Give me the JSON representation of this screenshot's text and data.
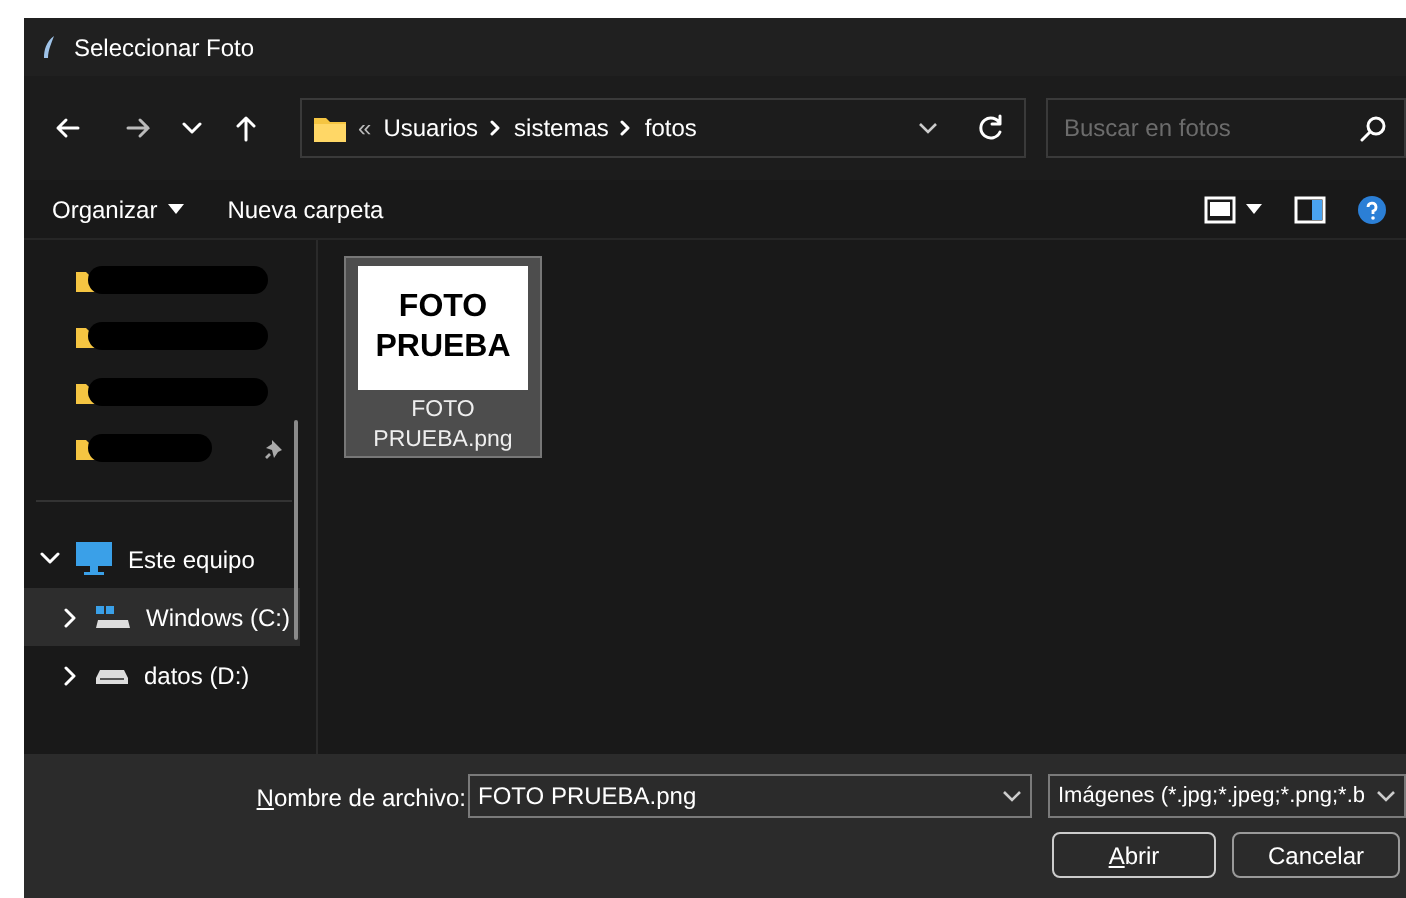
{
  "window": {
    "title": "Seleccionar Foto"
  },
  "address": {
    "overflow": "«",
    "segments": [
      "Usuarios",
      "sistemas",
      "fotos"
    ]
  },
  "search": {
    "placeholder": "Buscar en fotos"
  },
  "toolbar": {
    "organize": "Organizar",
    "new_folder": "Nueva carpeta"
  },
  "quick_access": [
    {
      "redacted": true,
      "pinned": false
    },
    {
      "redacted": true,
      "pinned": false
    },
    {
      "redacted": true,
      "pinned": false
    },
    {
      "redacted": true,
      "pinned": true
    }
  ],
  "tree": [
    {
      "label": "Este equipo",
      "kind": "computer",
      "expanded": true,
      "selected": false,
      "children": [
        {
          "label": "Windows (C:)",
          "kind": "system-drive",
          "expanded": false,
          "selected": true
        },
        {
          "label": "datos (D:)",
          "kind": "drive",
          "expanded": false,
          "selected": false
        }
      ]
    }
  ],
  "files": [
    {
      "thumbnail_text": "FOTO PRUEBA",
      "name": "FOTO PRUEBA.png",
      "selected": true
    }
  ],
  "footer": {
    "filename_label": {
      "accel": "N",
      "rest": "ombre de archivo:"
    },
    "filename": "FOTO PRUEBA.png",
    "filter": "Imágenes (*.jpg;*.jpeg;*.png;*.b",
    "open_button": {
      "accel": "A",
      "rest": "brir"
    },
    "cancel_button": "Cancelar"
  }
}
